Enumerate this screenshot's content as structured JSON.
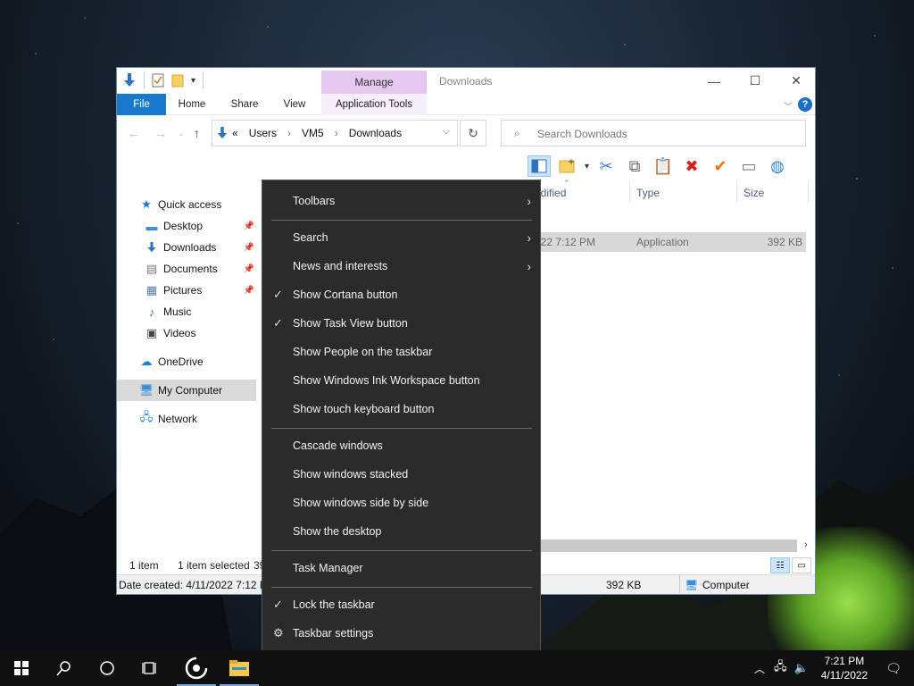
{
  "window": {
    "title": "Downloads",
    "manage_tab": "Manage",
    "tabs": [
      "File",
      "Home",
      "Share",
      "View",
      "Application Tools"
    ],
    "help": "?"
  },
  "address": {
    "prefix": "«",
    "crumbs": [
      "Users",
      "VM5",
      "Downloads"
    ],
    "search_placeholder": "Search Downloads"
  },
  "columns": {
    "modified": "odified",
    "type": "Type",
    "size": "Size"
  },
  "file": {
    "date": "022 7:12 PM",
    "type": "Application",
    "size": "392 KB"
  },
  "nav": {
    "quick_access": "Quick access",
    "items": [
      {
        "label": "Desktop",
        "icon": "desktop-icon",
        "pinned": true
      },
      {
        "label": "Downloads",
        "icon": "downloads-icon",
        "pinned": true
      },
      {
        "label": "Documents",
        "icon": "documents-icon",
        "pinned": true
      },
      {
        "label": "Pictures",
        "icon": "pictures-icon",
        "pinned": true
      },
      {
        "label": "Music",
        "icon": "music-icon",
        "pinned": false
      },
      {
        "label": "Videos",
        "icon": "videos-icon",
        "pinned": false
      }
    ],
    "onedrive": "OneDrive",
    "my_computer": "My Computer",
    "network": "Network"
  },
  "status": {
    "count": "1 item",
    "selected": "1 item selected",
    "selected_tail": "39",
    "date_created": "Date created: 4/11/2022 7:12 P",
    "size": "392 KB",
    "location": "Computer"
  },
  "context_menu": {
    "items": [
      {
        "label": "Toolbars",
        "submenu": true,
        "checked": false
      },
      {
        "label": "Search",
        "submenu": true,
        "checked": false
      },
      {
        "label": "News and interests",
        "submenu": true,
        "checked": false
      },
      {
        "label": "Show Cortana button",
        "submenu": false,
        "checked": true
      },
      {
        "label": "Show Task View button",
        "submenu": false,
        "checked": true
      },
      {
        "label": "Show People on the taskbar",
        "submenu": false,
        "checked": false
      },
      {
        "label": "Show Windows Ink Workspace button",
        "submenu": false,
        "checked": false
      },
      {
        "label": "Show touch keyboard button",
        "submenu": false,
        "checked": false
      },
      {
        "label": "Cascade windows",
        "submenu": false,
        "checked": false
      },
      {
        "label": "Show windows stacked",
        "submenu": false,
        "checked": false
      },
      {
        "label": "Show windows side by side",
        "submenu": false,
        "checked": false
      },
      {
        "label": "Show the desktop",
        "submenu": false,
        "checked": false
      },
      {
        "label": "Task Manager",
        "submenu": false,
        "checked": false
      },
      {
        "label": "Lock the taskbar",
        "submenu": false,
        "checked": true
      },
      {
        "label": "Taskbar settings",
        "submenu": false,
        "checked": false,
        "icon": "gear-icon"
      }
    ]
  },
  "taskbar": {
    "time": "7:21 PM",
    "date": "4/11/2022"
  },
  "colors": {
    "accent": "#1979ca",
    "manage_tab": "#e4c8f0",
    "menu_bg": "#2b2b2b"
  }
}
